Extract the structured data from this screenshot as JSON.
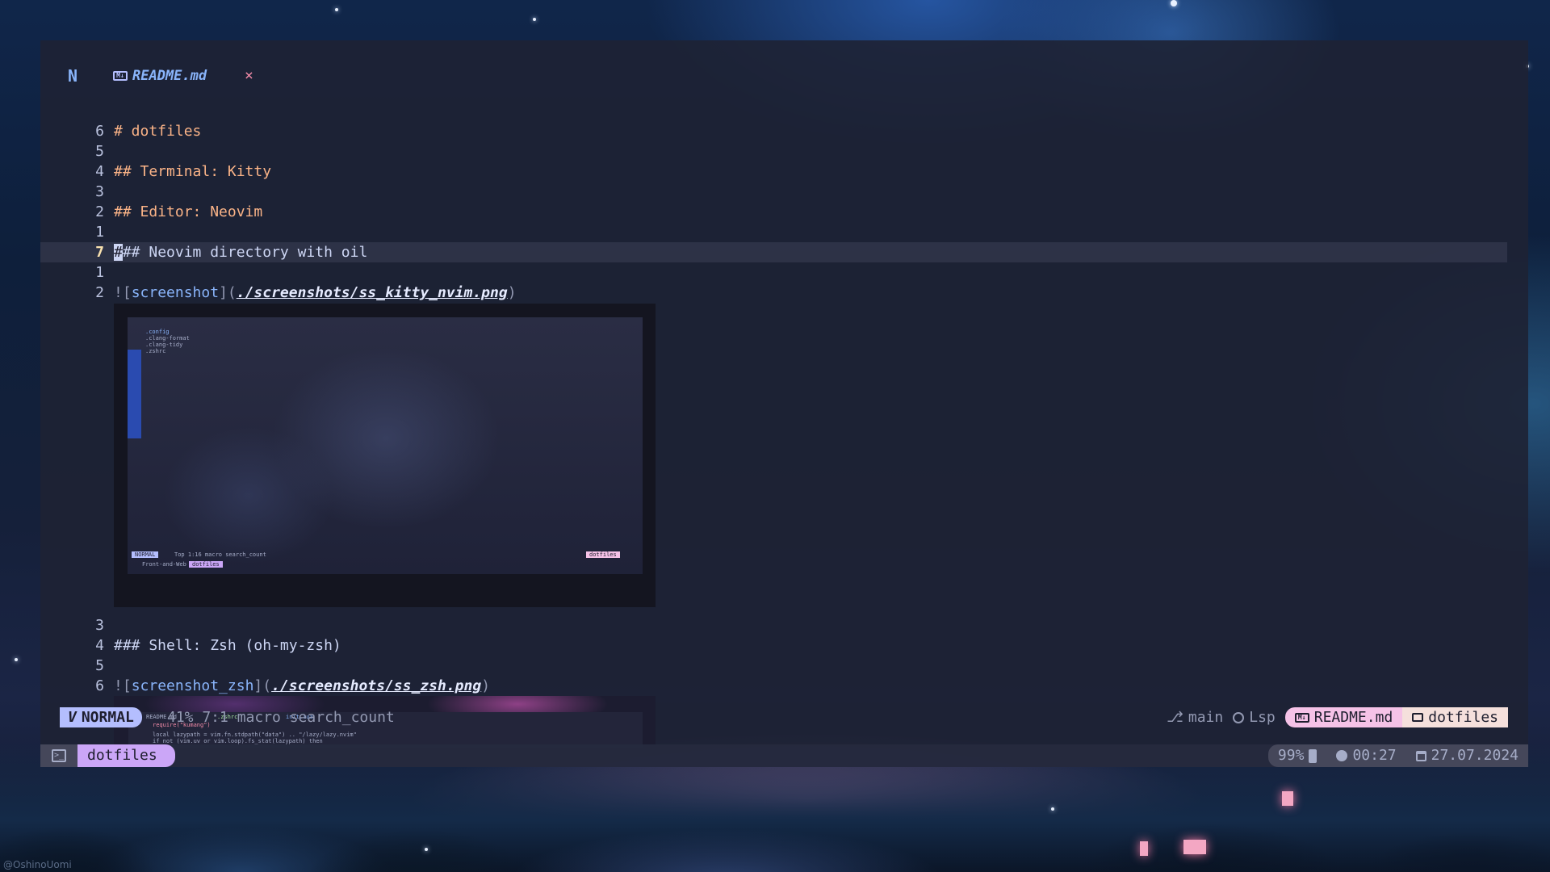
{
  "app": {
    "logo": "N",
    "tab": {
      "icon": "markdown-icon",
      "name": "README.md",
      "close": "×"
    }
  },
  "editor": {
    "lines": [
      {
        "num": "6",
        "text": "# dotfiles"
      },
      {
        "num": "5",
        "text": ""
      },
      {
        "num": "4",
        "text": "## Terminal: Kitty"
      },
      {
        "num": "3",
        "text": ""
      },
      {
        "num": "2",
        "text": "## Editor: Neovim"
      },
      {
        "num": "1",
        "text": ""
      },
      {
        "num": "7",
        "cursor_char": "#",
        "text_rest": "## Neovim directory with oil",
        "current": true
      },
      {
        "num": "1",
        "text": ""
      },
      {
        "num": "2",
        "prefix": "![",
        "link_text": "screenshot",
        "mid": "](",
        "url": "./screenshots/ss_kitty_nvim.png",
        "suffix": ")"
      },
      {
        "num": "3",
        "text": ""
      },
      {
        "num": "4",
        "text": "### Shell: Zsh (oh-my-zsh)"
      },
      {
        "num": "5",
        "text": ""
      },
      {
        "num": "6",
        "prefix": "![",
        "link_text": "screenshot_zsh",
        "mid": "](",
        "url": "./screenshots/ss_zsh.png",
        "suffix": ")"
      }
    ],
    "embed1": {
      "lines": [
        ".config",
        ".clang-format",
        ".clang-tidy",
        ".zshrc"
      ],
      "statusline": "NORMAL",
      "status_info": "Top 1:16 macro search_count",
      "tabline": "Front-and-Web",
      "tabline2": "dotfiles",
      "dotfiles_pill": "dotfiles"
    },
    "embed2": {
      "tabs": [
        "README.md",
        ".zshrc",
        "init.lua"
      ],
      "lines": [
        "require(\"kumang\")",
        "local lazypath = vim.fn.stdpath(\"data\") .. \"/lazy/lazy.nvim\"",
        "if not (vim.uv or vim.loop).fs_stat(lazypath) then"
      ]
    }
  },
  "statusline": {
    "mode": "NORMAL",
    "info": "41% 7:1 macro search_count",
    "git_branch": "main",
    "lsp": "Lsp",
    "file": "README.md",
    "dir": "dotfiles"
  },
  "kitty": {
    "tab": "dotfiles",
    "battery": "99%",
    "time": "00:27",
    "date": "27.07.2024"
  },
  "watermark": "@OshinoUomi",
  "colors": {
    "accent": "#b4befe",
    "heading": "#fab387",
    "link": "#89b4fa",
    "kitty_tab": "#cba6f7",
    "file_pill": "#f5c2e7"
  }
}
